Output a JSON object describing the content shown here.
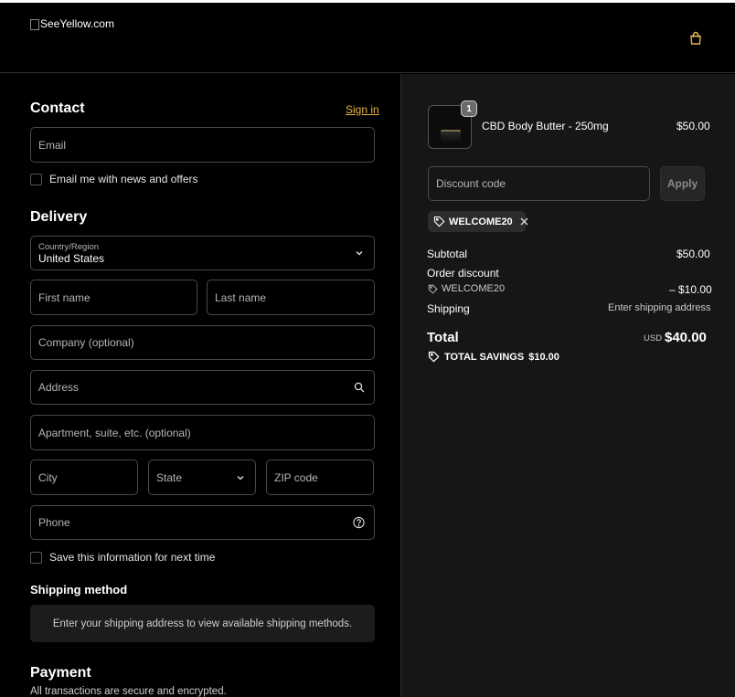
{
  "header": {
    "logo_alt": "SeeYellow.com"
  },
  "contact": {
    "title": "Contact",
    "sign_in": "Sign in",
    "email_placeholder": "Email",
    "newsletter_label": "Email me with news and offers"
  },
  "delivery": {
    "title": "Delivery",
    "country_label": "Country/Region",
    "country_value": "United States",
    "first_name": "First name",
    "last_name": "Last name",
    "company": "Company (optional)",
    "address": "Address",
    "apartment": "Apartment, suite, etc. (optional)",
    "city": "City",
    "state": "State",
    "zip": "ZIP code",
    "phone": "Phone",
    "save_info_label": "Save this information for next time"
  },
  "shipping_method": {
    "title": "Shipping method",
    "message": "Enter your shipping address to view available shipping methods."
  },
  "payment": {
    "title": "Payment",
    "subtitle": "All transactions are secure and encrypted."
  },
  "summary": {
    "item": {
      "name": "CBD Body Butter - 250mg",
      "price": "$50.00",
      "quantity": "1"
    },
    "discount_placeholder": "Discount code",
    "apply_label": "Apply",
    "applied_code": "WELCOME20",
    "subtotal_label": "Subtotal",
    "subtotal_value": "$50.00",
    "order_discount_label": "Order discount",
    "order_discount_code": "WELCOME20",
    "order_discount_value": "– $10.00",
    "shipping_label": "Shipping",
    "shipping_value": "Enter shipping address",
    "total_label": "Total",
    "currency": "USD",
    "total_value": "$40.00",
    "savings_label": "TOTAL SAVINGS",
    "savings_value": "$10.00"
  },
  "colors": {
    "accent": "#e8b64b",
    "background": "#000000",
    "summary_bg": "#161616"
  }
}
